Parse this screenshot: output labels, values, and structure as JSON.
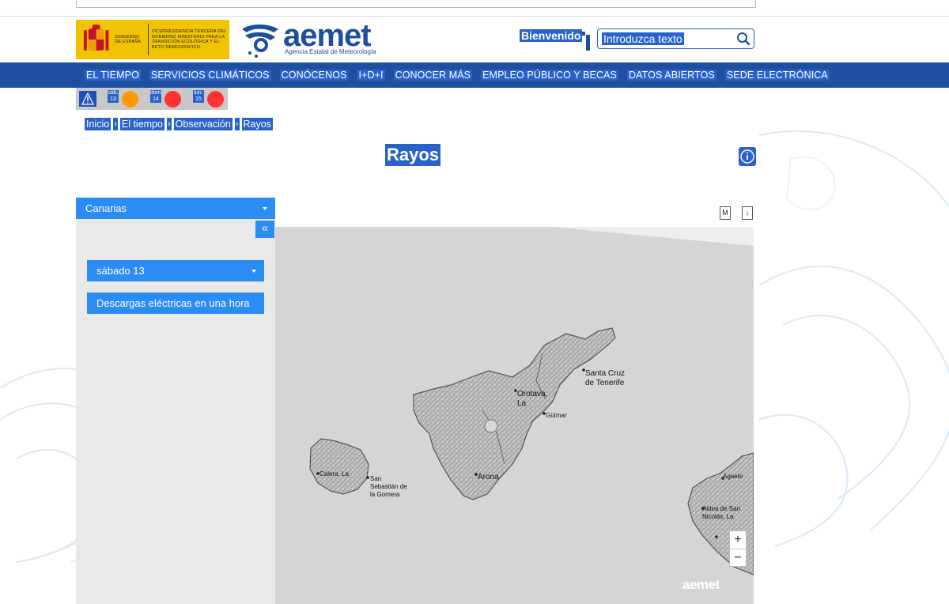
{
  "header": {
    "gov_logo_text": "GOBIERNO DE ESPAÑA",
    "ministry_text": "VICEPRESIDENCIA TERCERA DEL GOBIERNO MINISTERIO PARA LA TRANSICIÓN ECOLÓGICA Y EL RETO DEMOGRÁFICO",
    "brand": "aemet",
    "brand_subtitle": "Agencia Estatal de Meteorología",
    "welcome": "Bienvenido",
    "search_placeholder": "Introduzca texto"
  },
  "nav": {
    "items": [
      {
        "label": "EL TIEMPO"
      },
      {
        "label": "SERVICIOS CLIMÁTICOS"
      },
      {
        "label": "CONÓCENOS"
      },
      {
        "label": "I+D+I"
      },
      {
        "label": "CONOCER MÁS"
      },
      {
        "label": "EMPLEO PÚBLICO Y BECAS"
      },
      {
        "label": "DATOS ABIERTOS"
      },
      {
        "label": "SEDE ELECTRÓNICA"
      }
    ]
  },
  "warnings": {
    "days": [
      {
        "label": "sáb. 13",
        "level_color": "#ff9900"
      },
      {
        "label": "dom. 14",
        "level_color": "#ff3333"
      },
      {
        "label": "lun. 15",
        "level_color": "#ff3333"
      }
    ]
  },
  "breadcrumb": [
    "Inicio",
    "El tiempo",
    "Observación",
    "Rayos"
  ],
  "page_title": "Rayos",
  "sidebar": {
    "region": "Canarias",
    "collapse_label": "«",
    "day": "sábado 13",
    "product": "Descargas eléctricas en una hora"
  },
  "tools": {
    "metadata_label": "M",
    "download_label": "↓"
  },
  "map": {
    "places": {
      "santa_cruz": "Santa Cruz de Tenerife",
      "orotava": "Orotava, La",
      "guimar": "Güímar",
      "arona": "Arona",
      "san_sebastian": "San Sebastián de la Gomera",
      "calera": "Calera, La",
      "agaete": "Agaete",
      "aldea": "Aldea de San Nicolás, La"
    },
    "zoom_in": "+",
    "zoom_out": "−",
    "brand": "aemet"
  },
  "colors": {
    "nav_bg": "#1f4fa0",
    "accent": "#2b8cf3",
    "selection": "#2b62c9",
    "brand_blue": "#1f4e9c"
  }
}
